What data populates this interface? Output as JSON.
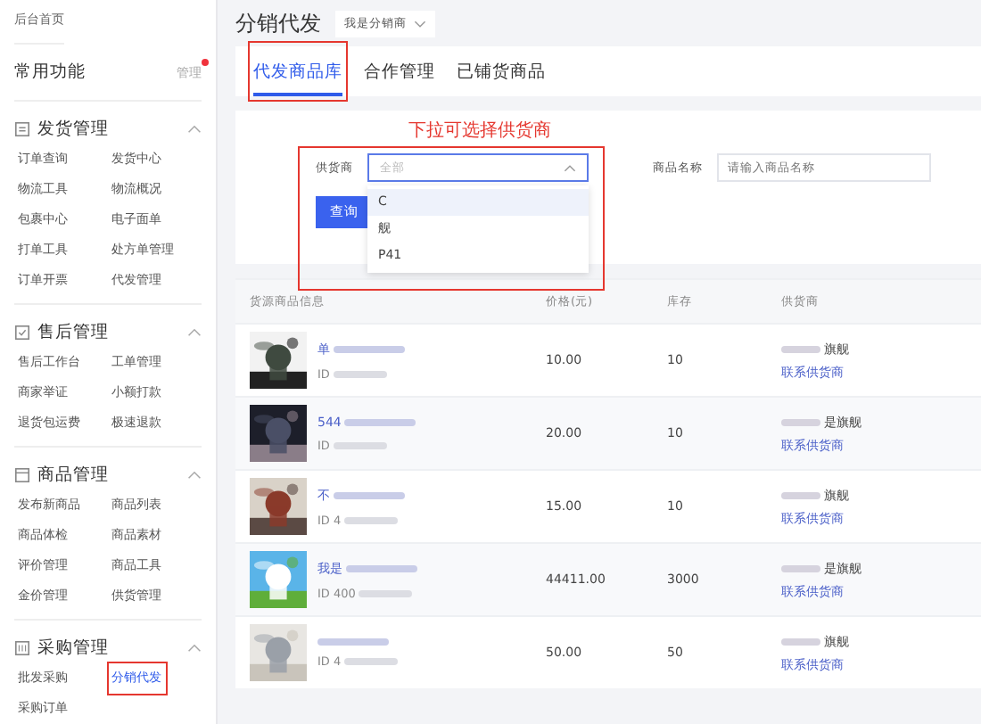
{
  "sidebar": {
    "home": "后台首页",
    "common": {
      "title": "常用功能",
      "action": "管理",
      "notice": true
    },
    "sections": [
      {
        "title": "发货管理",
        "expanded": true,
        "items": [
          {
            "label": "订单查询",
            "selected": false
          },
          {
            "label": "发货中心",
            "selected": false
          },
          {
            "label": "物流工具",
            "selected": false
          },
          {
            "label": "物流概况",
            "selected": false
          },
          {
            "label": "包裹中心",
            "selected": false
          },
          {
            "label": "电子面单",
            "selected": false
          },
          {
            "label": "打单工具",
            "selected": false
          },
          {
            "label": "处方单管理",
            "selected": false
          },
          {
            "label": "订单开票",
            "selected": false
          },
          {
            "label": "代发管理",
            "selected": false
          }
        ]
      },
      {
        "title": "售后管理",
        "expanded": true,
        "items": [
          {
            "label": "售后工作台",
            "selected": false
          },
          {
            "label": "工单管理",
            "selected": false
          },
          {
            "label": "商家举证",
            "selected": false
          },
          {
            "label": "小额打款",
            "selected": false
          },
          {
            "label": "退货包运费",
            "selected": false
          },
          {
            "label": "极速退款",
            "selected": false
          }
        ]
      },
      {
        "title": "商品管理",
        "expanded": true,
        "items": [
          {
            "label": "发布新商品",
            "selected": false
          },
          {
            "label": "商品列表",
            "selected": false
          },
          {
            "label": "商品体检",
            "selected": false
          },
          {
            "label": "商品素材",
            "selected": false
          },
          {
            "label": "评价管理",
            "selected": false
          },
          {
            "label": "商品工具",
            "selected": false
          },
          {
            "label": "金价管理",
            "selected": false
          },
          {
            "label": "供货管理",
            "selected": false
          }
        ]
      },
      {
        "title": "采购管理",
        "expanded": true,
        "items": [
          {
            "label": "批发采购",
            "selected": false
          },
          {
            "label": "分销代发",
            "selected": true
          },
          {
            "label": "采购订单",
            "selected": false
          }
        ]
      }
    ]
  },
  "page": {
    "title": "分销代发",
    "role_select": "我是分销商"
  },
  "tabs": [
    {
      "label": "代发商品库",
      "selected": true
    },
    {
      "label": "合作管理",
      "selected": false
    },
    {
      "label": "已铺货商品",
      "selected": false
    }
  ],
  "annotation": "下拉可选择供货商",
  "filters": {
    "supplier": {
      "label": "供货商",
      "placeholder": "全部",
      "expanded": true,
      "options": [
        {
          "label": "C",
          "selected": true
        },
        {
          "label": "舰",
          "selected": false
        },
        {
          "label": "P41",
          "selected": false
        }
      ]
    },
    "product_name": {
      "label": "商品名称",
      "placeholder": "请输入商品名称"
    },
    "query_button": "查询"
  },
  "table": {
    "columns": [
      "货源商品信息",
      "价格(元)",
      "库存",
      "供货商"
    ],
    "rows": [
      {
        "title": "单",
        "id": "ID",
        "price": "10.00",
        "stock": "10",
        "supplier": "旗舰",
        "contact": "联系供货商"
      },
      {
        "title": "544",
        "id": "ID",
        "price": "20.00",
        "stock": "10",
        "supplier": "是旗舰",
        "contact": "联系供货商"
      },
      {
        "title": "不",
        "id": "ID 4",
        "price": "15.00",
        "stock": "10",
        "supplier": "旗舰",
        "contact": "联系供货商"
      },
      {
        "title": "我是",
        "id": "ID 400",
        "price": "44411.00",
        "stock": "3000",
        "supplier": "是旗舰",
        "contact": "联系供货商"
      },
      {
        "id": "ID 4",
        "price": "50.00",
        "stock": "50",
        "supplier": "旗舰",
        "contact": "联系供货商"
      }
    ]
  }
}
